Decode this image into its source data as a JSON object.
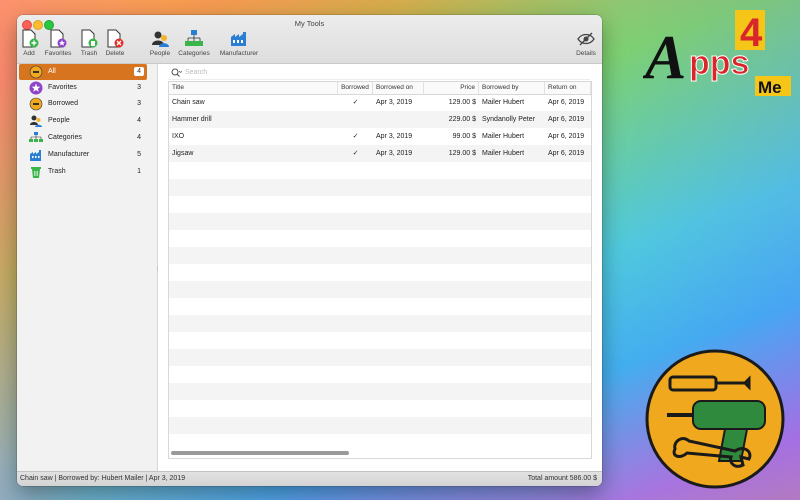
{
  "window": {
    "title": "My Tools"
  },
  "toolbar": {
    "add": "Add",
    "favorites": "Favorites",
    "trash": "Trash",
    "delete": "Delete",
    "people": "People",
    "categories": "Categories",
    "manufacturer": "Manufacturer",
    "details": "Details"
  },
  "sidebar": {
    "items": [
      {
        "label": "All",
        "count": "4",
        "icon": "all-tools-icon"
      },
      {
        "label": "Favorites",
        "count": "3",
        "icon": "star-icon"
      },
      {
        "label": "Borrowed",
        "count": "3",
        "icon": "borrowed-tools-icon"
      },
      {
        "label": "People",
        "count": "4",
        "icon": "people-icon"
      },
      {
        "label": "Categories",
        "count": "4",
        "icon": "categories-icon"
      },
      {
        "label": "Manufacturer",
        "count": "5",
        "icon": "factory-icon"
      },
      {
        "label": "Trash",
        "count": "1",
        "icon": "trash-icon"
      }
    ]
  },
  "search": {
    "placeholder": "Search"
  },
  "table": {
    "columns": [
      "Title",
      "Borrowed",
      "Borrowed on",
      "Price",
      "Borrowed by",
      "Return on"
    ],
    "rows": [
      {
        "title": "Chain saw",
        "borrowed": "✓",
        "borrowed_on": "Apr 3, 2019",
        "price": "129.00 $",
        "borrowed_by": "Mailer Hubert",
        "return_on": "Apr 6, 2019"
      },
      {
        "title": "Hammer drill",
        "borrowed": "",
        "borrowed_on": "",
        "price": "229.00 $",
        "borrowed_by": "Syndanolly Peter",
        "return_on": "Apr 6, 2019"
      },
      {
        "title": "IXO",
        "borrowed": "✓",
        "borrowed_on": "Apr 3, 2019",
        "price": "99.00 $",
        "borrowed_by": "Mailer Hubert",
        "return_on": "Apr 6, 2019"
      },
      {
        "title": "Jigsaw",
        "borrowed": "✓",
        "borrowed_on": "Apr 3, 2019",
        "price": "129.00 $",
        "borrowed_by": "Mailer Hubert",
        "return_on": "Apr 6, 2019"
      }
    ]
  },
  "status": {
    "left": "Chain saw | Borrowed by: Hubert Mailer | Apr 3, 2019",
    "right": "Total amount 586.00 $"
  },
  "branding": {
    "logo_letter_a": "A",
    "logo_pps": "pps",
    "logo_4": "4",
    "logo_me": "Me"
  },
  "colors": {
    "selection": "#d6741f",
    "logo_red": "#d8262a",
    "logo_yellow": "#f5c518",
    "badge_orange": "#f0a81e"
  }
}
